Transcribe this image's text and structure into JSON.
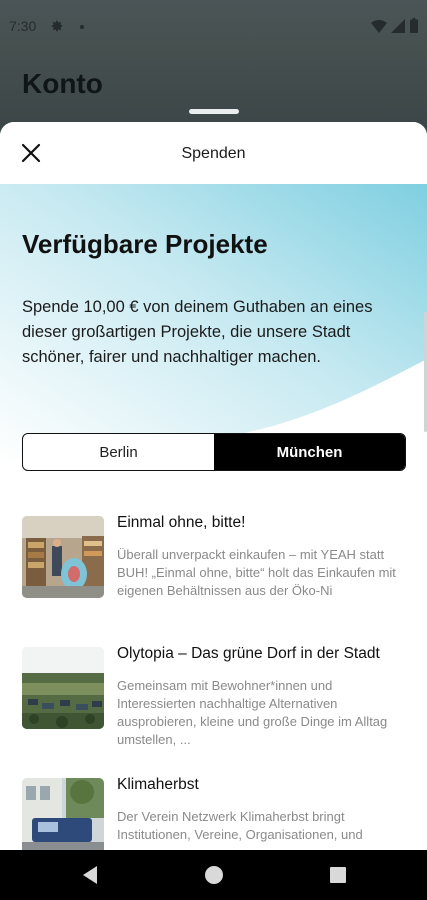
{
  "status_bar": {
    "time": "7:30"
  },
  "background_screen": {
    "title": "Konto"
  },
  "sheet": {
    "title": "Spenden",
    "hero": {
      "heading": "Verfügbare Projekte",
      "text": "Spende 10,00 € von deinem Guthaben an eines dieser großartigen Projekte, die unsere Stadt schöner, fairer und nachhaltiger machen."
    },
    "city_toggle": {
      "options": [
        "Berlin",
        "München"
      ],
      "selected": "München"
    },
    "projects": [
      {
        "title": "Einmal ohne, bitte!",
        "description": "Überall unverpackt einkaufen – mit YEAH statt BUH! „Einmal ohne, bitte“ holt das Einkaufen mit eigenen Behältnissen aus der Öko-Ni"
      },
      {
        "title": "Olytopia – Das grüne Dorf in der Stadt",
        "description": "Gemeinsam mit Bewohner*innen und Interessierten nachhaltige Alternativen ausprobieren, kleine und große Dinge im Alltag umstellen, ..."
      },
      {
        "title": "Klimaherbst",
        "description": "Der Verein Netzwerk Klimaherbst bringt Institutionen, Vereine, Organisationen, und"
      }
    ]
  },
  "colors": {
    "accent": "#000000",
    "hero_gradient": "#8fd3e3",
    "muted_text": "#8a8a8a"
  },
  "icons": [
    "settings-icon",
    "wifi-icon",
    "signal-icon",
    "battery-icon",
    "close-icon",
    "back-icon",
    "home-icon",
    "recents-icon"
  ]
}
